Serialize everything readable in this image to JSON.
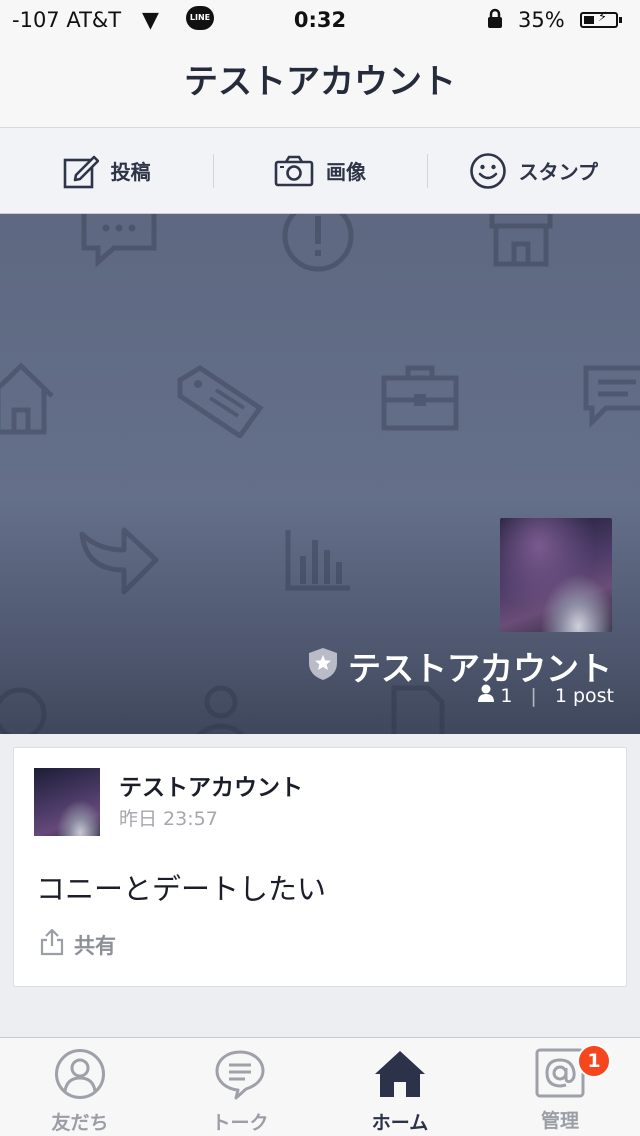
{
  "status_bar": {
    "carrier": "-107 AT&T",
    "wifi_icon": "▼",
    "line_badge": "LINE",
    "time": "0:32",
    "battery_percent": "35%",
    "battery_level": 0.35
  },
  "nav": {
    "title": "テストアカウント"
  },
  "actions": [
    {
      "icon": "compose-icon",
      "label": "投稿"
    },
    {
      "icon": "camera-icon",
      "label": "画像"
    },
    {
      "icon": "smiley-icon",
      "label": "スタンプ"
    }
  ],
  "cover": {
    "account_name": "テストアカウント",
    "followers": "1",
    "posts": "1 post"
  },
  "post": {
    "author": "テストアカウント",
    "time": "昨日 23:57",
    "body": "コニーとデートしたい",
    "share_label": "共有"
  },
  "tabs": [
    {
      "icon": "friends-icon",
      "label": "友だち",
      "active": false
    },
    {
      "icon": "talk-icon",
      "label": "トーク",
      "active": false
    },
    {
      "icon": "home-icon",
      "label": "ホーム",
      "active": true
    },
    {
      "icon": "manage-icon",
      "label": "管理",
      "active": false,
      "badge": "1"
    }
  ],
  "colors": {
    "accent": "#2b3249",
    "badge": "#f5461e",
    "cover": "#646f8a"
  }
}
